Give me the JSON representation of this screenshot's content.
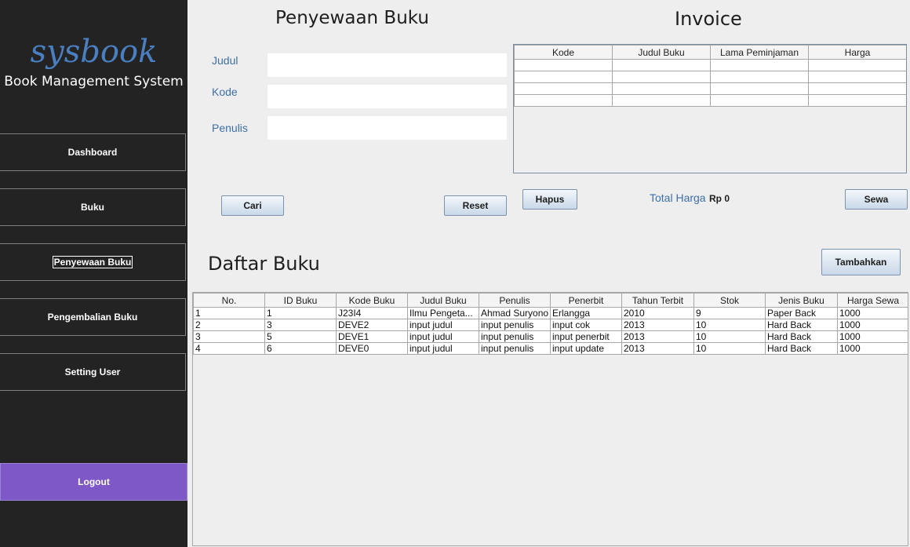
{
  "sidebar": {
    "brand_title": "sysbook",
    "brand_subtitle": "Book Management System",
    "menu": [
      "Dashboard",
      "Buku",
      "Penyewaan Buku",
      "Pengembalian Buku",
      "Setting User"
    ],
    "logout": "Logout"
  },
  "form": {
    "title": "Penyewaan Buku",
    "judul_label": "Judul",
    "kode_label": "Kode",
    "penulis_label": "Penulis",
    "judul_value": "",
    "kode_value": "",
    "penulis_value": "",
    "cari": "Cari",
    "reset": "Reset"
  },
  "invoice": {
    "title": "Invoice",
    "columns": [
      "Kode",
      "Judul Buku",
      "Lama Peminjaman",
      "Harga"
    ],
    "rows": [
      [
        "",
        "",
        "",
        ""
      ],
      [
        "",
        "",
        "",
        ""
      ],
      [
        "",
        "",
        "",
        ""
      ],
      [
        "",
        "",
        "",
        ""
      ]
    ],
    "hapus": "Hapus",
    "total_label": "Total Harga",
    "total_value": "Rp 0",
    "sewa": "Sewa"
  },
  "daftar": {
    "title": "Daftar Buku",
    "tambahkan": "Tambahkan",
    "columns": [
      "No.",
      "ID Buku",
      "Kode Buku",
      "Judul Buku",
      "Penulis",
      "Penerbit",
      "Tahun Terbit",
      "Stok",
      "Jenis Buku",
      "Harga Sewa"
    ],
    "rows": [
      [
        "1",
        "1",
        "J23I4",
        "Ilmu Pengeta...",
        "Ahmad Suryono",
        "Erlangga",
        "2010",
        "9",
        "Paper Back",
        "1000"
      ],
      [
        "2",
        "3",
        "DEVE2",
        "input judul",
        "input penulis",
        "input cok",
        "2013",
        "10",
        "Hard Back",
        "1000"
      ],
      [
        "3",
        "5",
        "DEVE1",
        "input judul",
        "input penulis",
        "input penerbit",
        "2013",
        "10",
        "Hard Back",
        "1000"
      ],
      [
        "4",
        "6",
        "DEVE0",
        "input judul",
        "input penulis",
        "input update",
        "2013",
        "10",
        "Hard Back",
        "1000"
      ]
    ]
  },
  "colors": {
    "sidebar_bg": "#232323",
    "accent_blue": "#4a7fc1",
    "logout_bg": "#7d58c6"
  }
}
